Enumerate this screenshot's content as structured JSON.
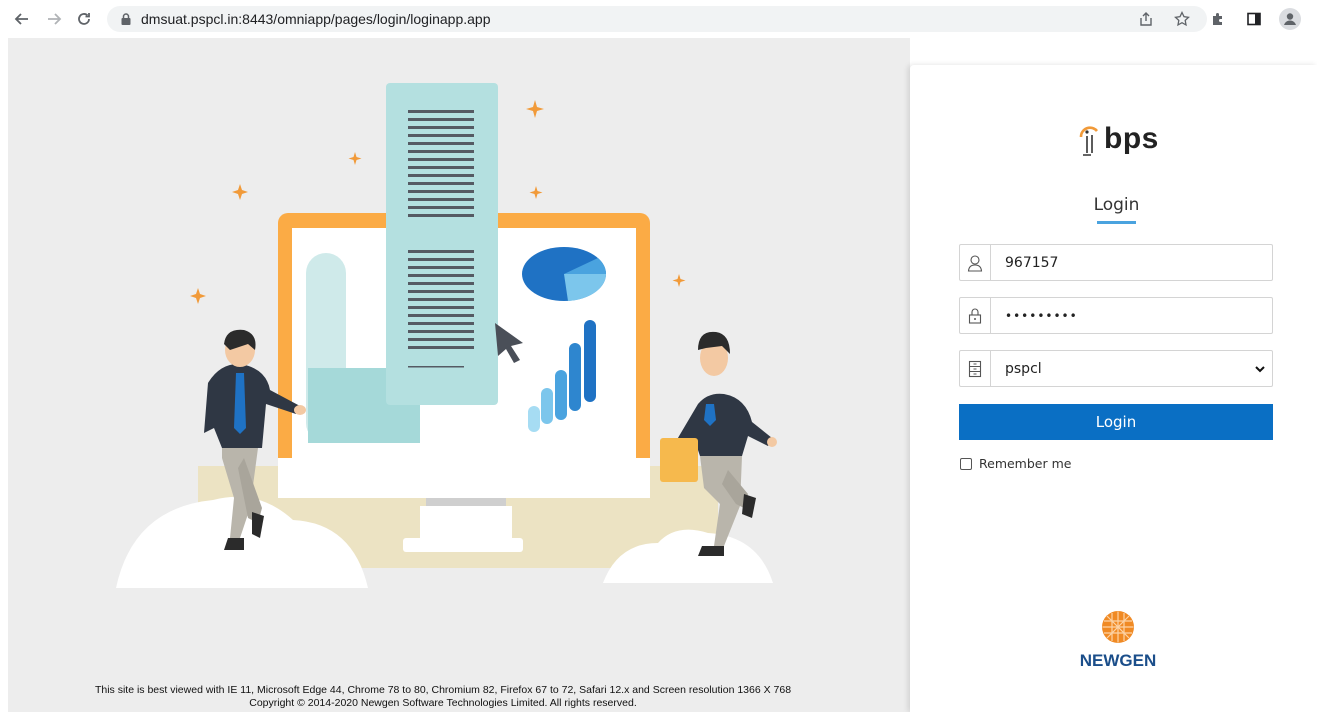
{
  "browser": {
    "url": "dmsuat.pspcl.in:8443/omniapp/pages/login/loginapp.app"
  },
  "login": {
    "logo_text": "bps",
    "heading": "Login",
    "username_value": "967157",
    "password_value": "•••••••••",
    "domain_selected": "pspcl",
    "submit_label": "Login",
    "remember_label": "Remember me",
    "accent_color": "#0a6fc4"
  },
  "brand": {
    "vendor_name": "NEWGEN"
  },
  "footer": {
    "compat_note": "This site is best viewed with IE 11, Microsoft Edge 44, Chrome 78 to 80, Chromium 82, Firefox 67 to 72, Safari 12.x and Screen resolution 1366 X 768",
    "copyright": "Copyright © 2014-2020 Newgen Software Technologies Limited. All rights reserved."
  }
}
